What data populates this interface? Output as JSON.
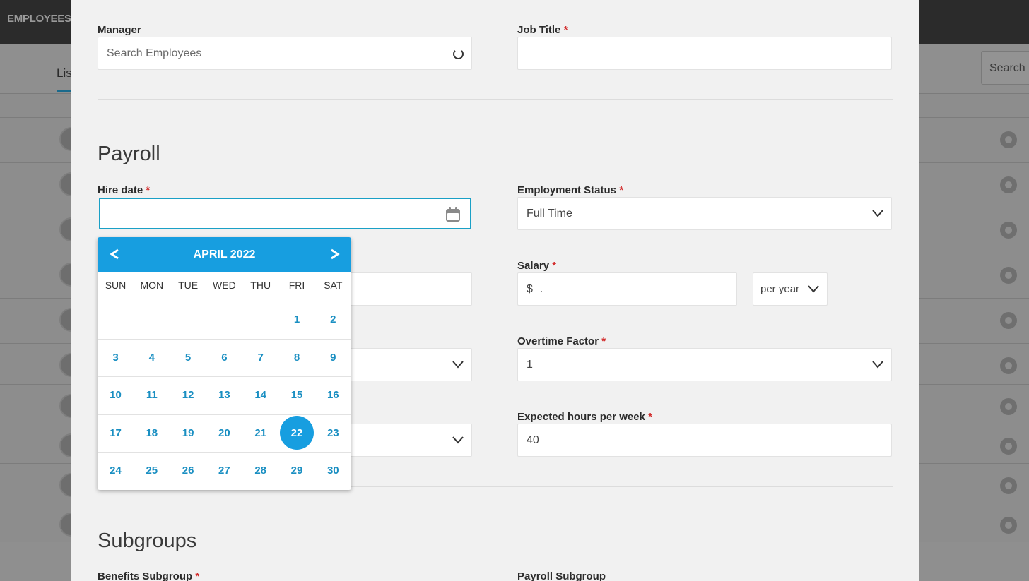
{
  "background": {
    "brand": "EMPLOYEES",
    "tab_label": "Lis",
    "search_placeholder": "Search E"
  },
  "modal": {
    "manager": {
      "label": "Manager",
      "placeholder": "Search Employees"
    },
    "job_title": {
      "label": "Job Title",
      "required": "*",
      "value": ""
    },
    "payroll_section": "Payroll",
    "hire_date": {
      "label": "Hire date",
      "required": "*",
      "value": ""
    },
    "employment_status": {
      "label": "Employment Status",
      "required": "*",
      "value": "Full Time"
    },
    "salary": {
      "label": "Salary",
      "required": "*",
      "currency": "$",
      "value": ".",
      "period": "per year"
    },
    "overtime_factor": {
      "label": "Overtime Factor",
      "required": "*",
      "value": "1"
    },
    "expected_hours": {
      "label": "Expected hours per week",
      "required": "*",
      "value": "40"
    },
    "subgroups_section": "Subgroups",
    "benefits_subgroup": {
      "label": "Benefits Subgroup",
      "required": "*"
    },
    "payroll_subgroup": {
      "label": "Payroll Subgroup"
    }
  },
  "calendar": {
    "title": "APRIL 2022",
    "prev_icon": "chevron-left-icon",
    "next_icon": "chevron-right-icon",
    "weekdays": [
      "SUN",
      "MON",
      "TUE",
      "WED",
      "THU",
      "FRI",
      "SAT"
    ],
    "first_weekday_index": 5,
    "days_in_month": 30,
    "selected_day": 22
  },
  "colors": {
    "accent": "#179ee0",
    "day_text": "#1a8fc2",
    "required": "#d32f2f",
    "focus_border": "#1aa0c6"
  }
}
